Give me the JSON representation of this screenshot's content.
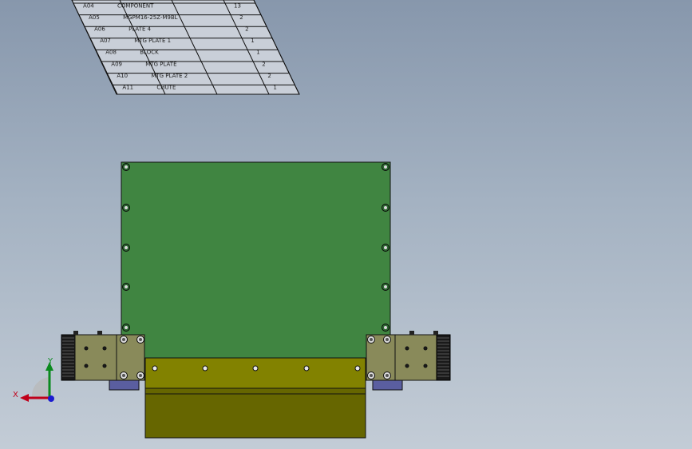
{
  "bom": {
    "rows": [
      {
        "item": "A04",
        "description": "COMPONENT",
        "qty": "13"
      },
      {
        "item": "A05",
        "description": "MGPM16-25Z-M9BL",
        "qty": "2"
      },
      {
        "item": "A06",
        "description": "PLATE 4",
        "qty": "2"
      },
      {
        "item": "A07",
        "description": "MTG PLATE 1",
        "qty": "1"
      },
      {
        "item": "A08",
        "description": "BLOCK",
        "qty": "1"
      },
      {
        "item": "A09",
        "description": "MTG PLATE",
        "qty": "2"
      },
      {
        "item": "A10",
        "description": "MTG PLATE 2",
        "qty": "2"
      },
      {
        "item": "A11",
        "description": "CHUTE",
        "qty": "1"
      }
    ]
  },
  "triad": {
    "x_label": "X",
    "y_label": "Y",
    "x_color": "#c0001a",
    "y_color": "#0a8a1e",
    "z_color": "#1b1bd0"
  },
  "colors": {
    "plate_green": "#408541",
    "chute_olive": "#828200",
    "chute_dark": "#666600",
    "block_olive": "#898a5a",
    "cylinder_dark": "#1a1a1a",
    "mount_purple": "#5a5ea0"
  }
}
